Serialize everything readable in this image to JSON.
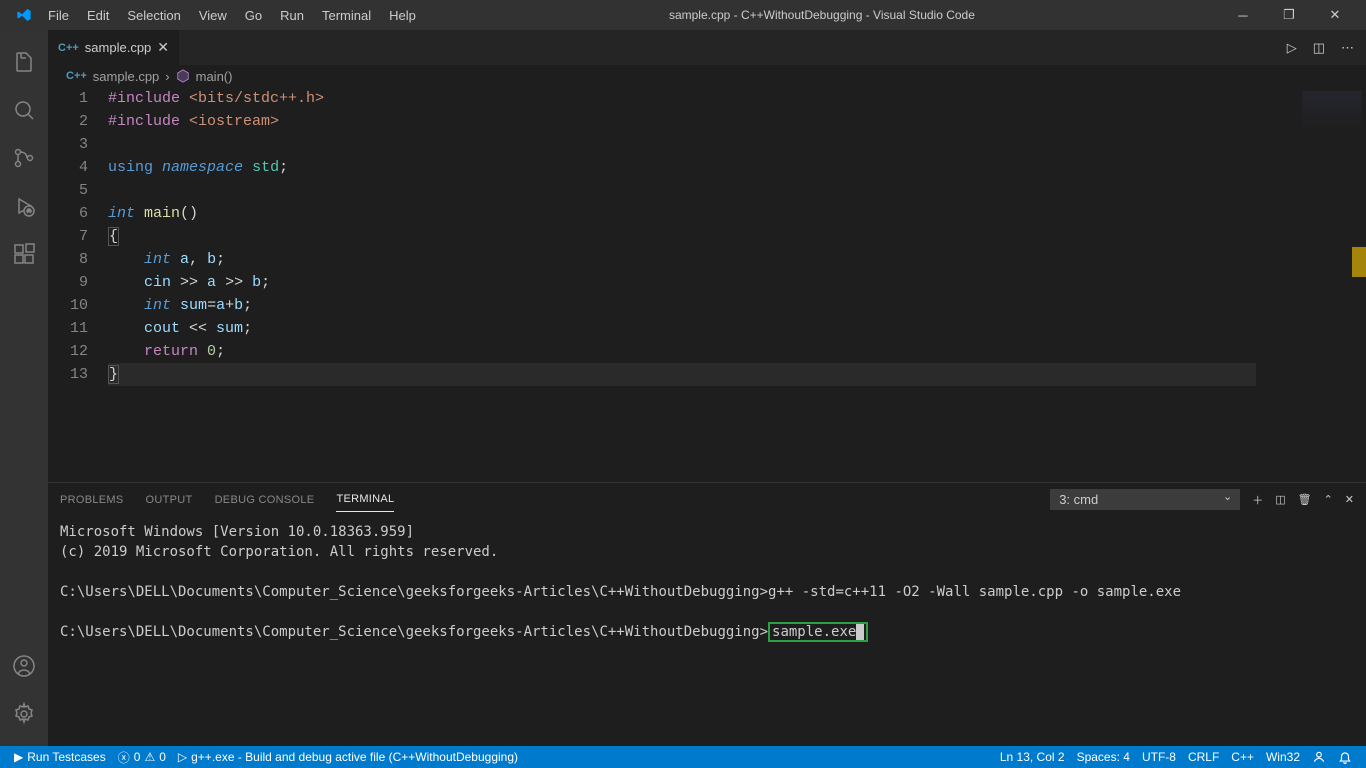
{
  "titlebar": {
    "title": "sample.cpp - C++WithoutDebugging - Visual Studio Code",
    "menu": [
      "File",
      "Edit",
      "Selection",
      "View",
      "Go",
      "Run",
      "Terminal",
      "Help"
    ]
  },
  "tab": {
    "filename": "sample.cpp"
  },
  "breadcrumb": {
    "file": "sample.cpp",
    "symbol": "main()"
  },
  "code": {
    "lines": [
      {
        "n": 1,
        "tokens": [
          {
            "t": "#include",
            "c": "kw-purple"
          },
          {
            "t": " ",
            "c": ""
          },
          {
            "t": "<bits/stdc++.h>",
            "c": "str"
          }
        ]
      },
      {
        "n": 2,
        "tokens": [
          {
            "t": "#include",
            "c": "kw-purple"
          },
          {
            "t": " ",
            "c": ""
          },
          {
            "t": "<iostream>",
            "c": "str"
          }
        ]
      },
      {
        "n": 3,
        "tokens": []
      },
      {
        "n": 4,
        "tokens": [
          {
            "t": "using",
            "c": "kw-blue"
          },
          {
            "t": " ",
            "c": ""
          },
          {
            "t": "namespace",
            "c": "kw-blue-italic"
          },
          {
            "t": " ",
            "c": ""
          },
          {
            "t": "std",
            "c": "type"
          },
          {
            "t": ";",
            "c": ""
          }
        ]
      },
      {
        "n": 5,
        "tokens": []
      },
      {
        "n": 6,
        "tokens": [
          {
            "t": "int",
            "c": "kw-blue-italic"
          },
          {
            "t": " ",
            "c": ""
          },
          {
            "t": "main",
            "c": "fn"
          },
          {
            "t": "()",
            "c": ""
          }
        ]
      },
      {
        "n": 7,
        "tokens": [
          {
            "t": "{",
            "c": "brace-hl"
          }
        ]
      },
      {
        "n": 8,
        "tokens": [
          {
            "t": "    ",
            "c": ""
          },
          {
            "t": "int",
            "c": "kw-blue-italic"
          },
          {
            "t": " ",
            "c": ""
          },
          {
            "t": "a",
            "c": "var"
          },
          {
            "t": ", ",
            "c": ""
          },
          {
            "t": "b",
            "c": "var"
          },
          {
            "t": ";",
            "c": ""
          }
        ]
      },
      {
        "n": 9,
        "tokens": [
          {
            "t": "    ",
            "c": ""
          },
          {
            "t": "cin",
            "c": "var"
          },
          {
            "t": " >> ",
            "c": ""
          },
          {
            "t": "a",
            "c": "var"
          },
          {
            "t": " >> ",
            "c": ""
          },
          {
            "t": "b",
            "c": "var"
          },
          {
            "t": ";",
            "c": ""
          }
        ]
      },
      {
        "n": 10,
        "tokens": [
          {
            "t": "    ",
            "c": ""
          },
          {
            "t": "int",
            "c": "kw-blue-italic"
          },
          {
            "t": " ",
            "c": ""
          },
          {
            "t": "sum",
            "c": "var"
          },
          {
            "t": "=",
            "c": ""
          },
          {
            "t": "a",
            "c": "var"
          },
          {
            "t": "+",
            "c": ""
          },
          {
            "t": "b",
            "c": "var"
          },
          {
            "t": ";",
            "c": ""
          }
        ]
      },
      {
        "n": 11,
        "tokens": [
          {
            "t": "    ",
            "c": ""
          },
          {
            "t": "cout",
            "c": "var"
          },
          {
            "t": " << ",
            "c": ""
          },
          {
            "t": "sum",
            "c": "var"
          },
          {
            "t": ";",
            "c": ""
          }
        ]
      },
      {
        "n": 12,
        "tokens": [
          {
            "t": "    ",
            "c": ""
          },
          {
            "t": "return",
            "c": "kw-purple"
          },
          {
            "t": " ",
            "c": ""
          },
          {
            "t": "0",
            "c": "num"
          },
          {
            "t": ";",
            "c": ""
          }
        ]
      },
      {
        "n": 13,
        "tokens": [
          {
            "t": "}",
            "c": "brace-hl"
          }
        ],
        "current": true
      }
    ]
  },
  "panel": {
    "tabs": [
      "PROBLEMS",
      "OUTPUT",
      "DEBUG CONSOLE",
      "TERMINAL"
    ],
    "active": 3,
    "terminalSelect": "3: cmd",
    "terminal": {
      "line1": "Microsoft Windows [Version 10.0.18363.959]",
      "line2": "(c) 2019 Microsoft Corporation. All rights reserved.",
      "line3": "C:\\Users\\DELL\\Documents\\Computer_Science\\geeksforgeeks-Articles\\C++WithoutDebugging>g++ -std=c++11 -O2 -Wall sample.cpp -o sample.exe",
      "prompt2": "C:\\Users\\DELL\\Documents\\Computer_Science\\geeksforgeeks-Articles\\C++WithoutDebugging>",
      "highlighted": "sample.exe"
    }
  },
  "status": {
    "runTestcases": "Run Testcases",
    "errors": "0",
    "warnings": "0",
    "buildTask": "g++.exe - Build and debug active file (C++WithoutDebugging)",
    "lineCol": "Ln 13, Col 2",
    "spaces": "Spaces: 4",
    "encoding": "UTF-8",
    "eol": "CRLF",
    "lang": "C++",
    "platform": "Win32"
  }
}
